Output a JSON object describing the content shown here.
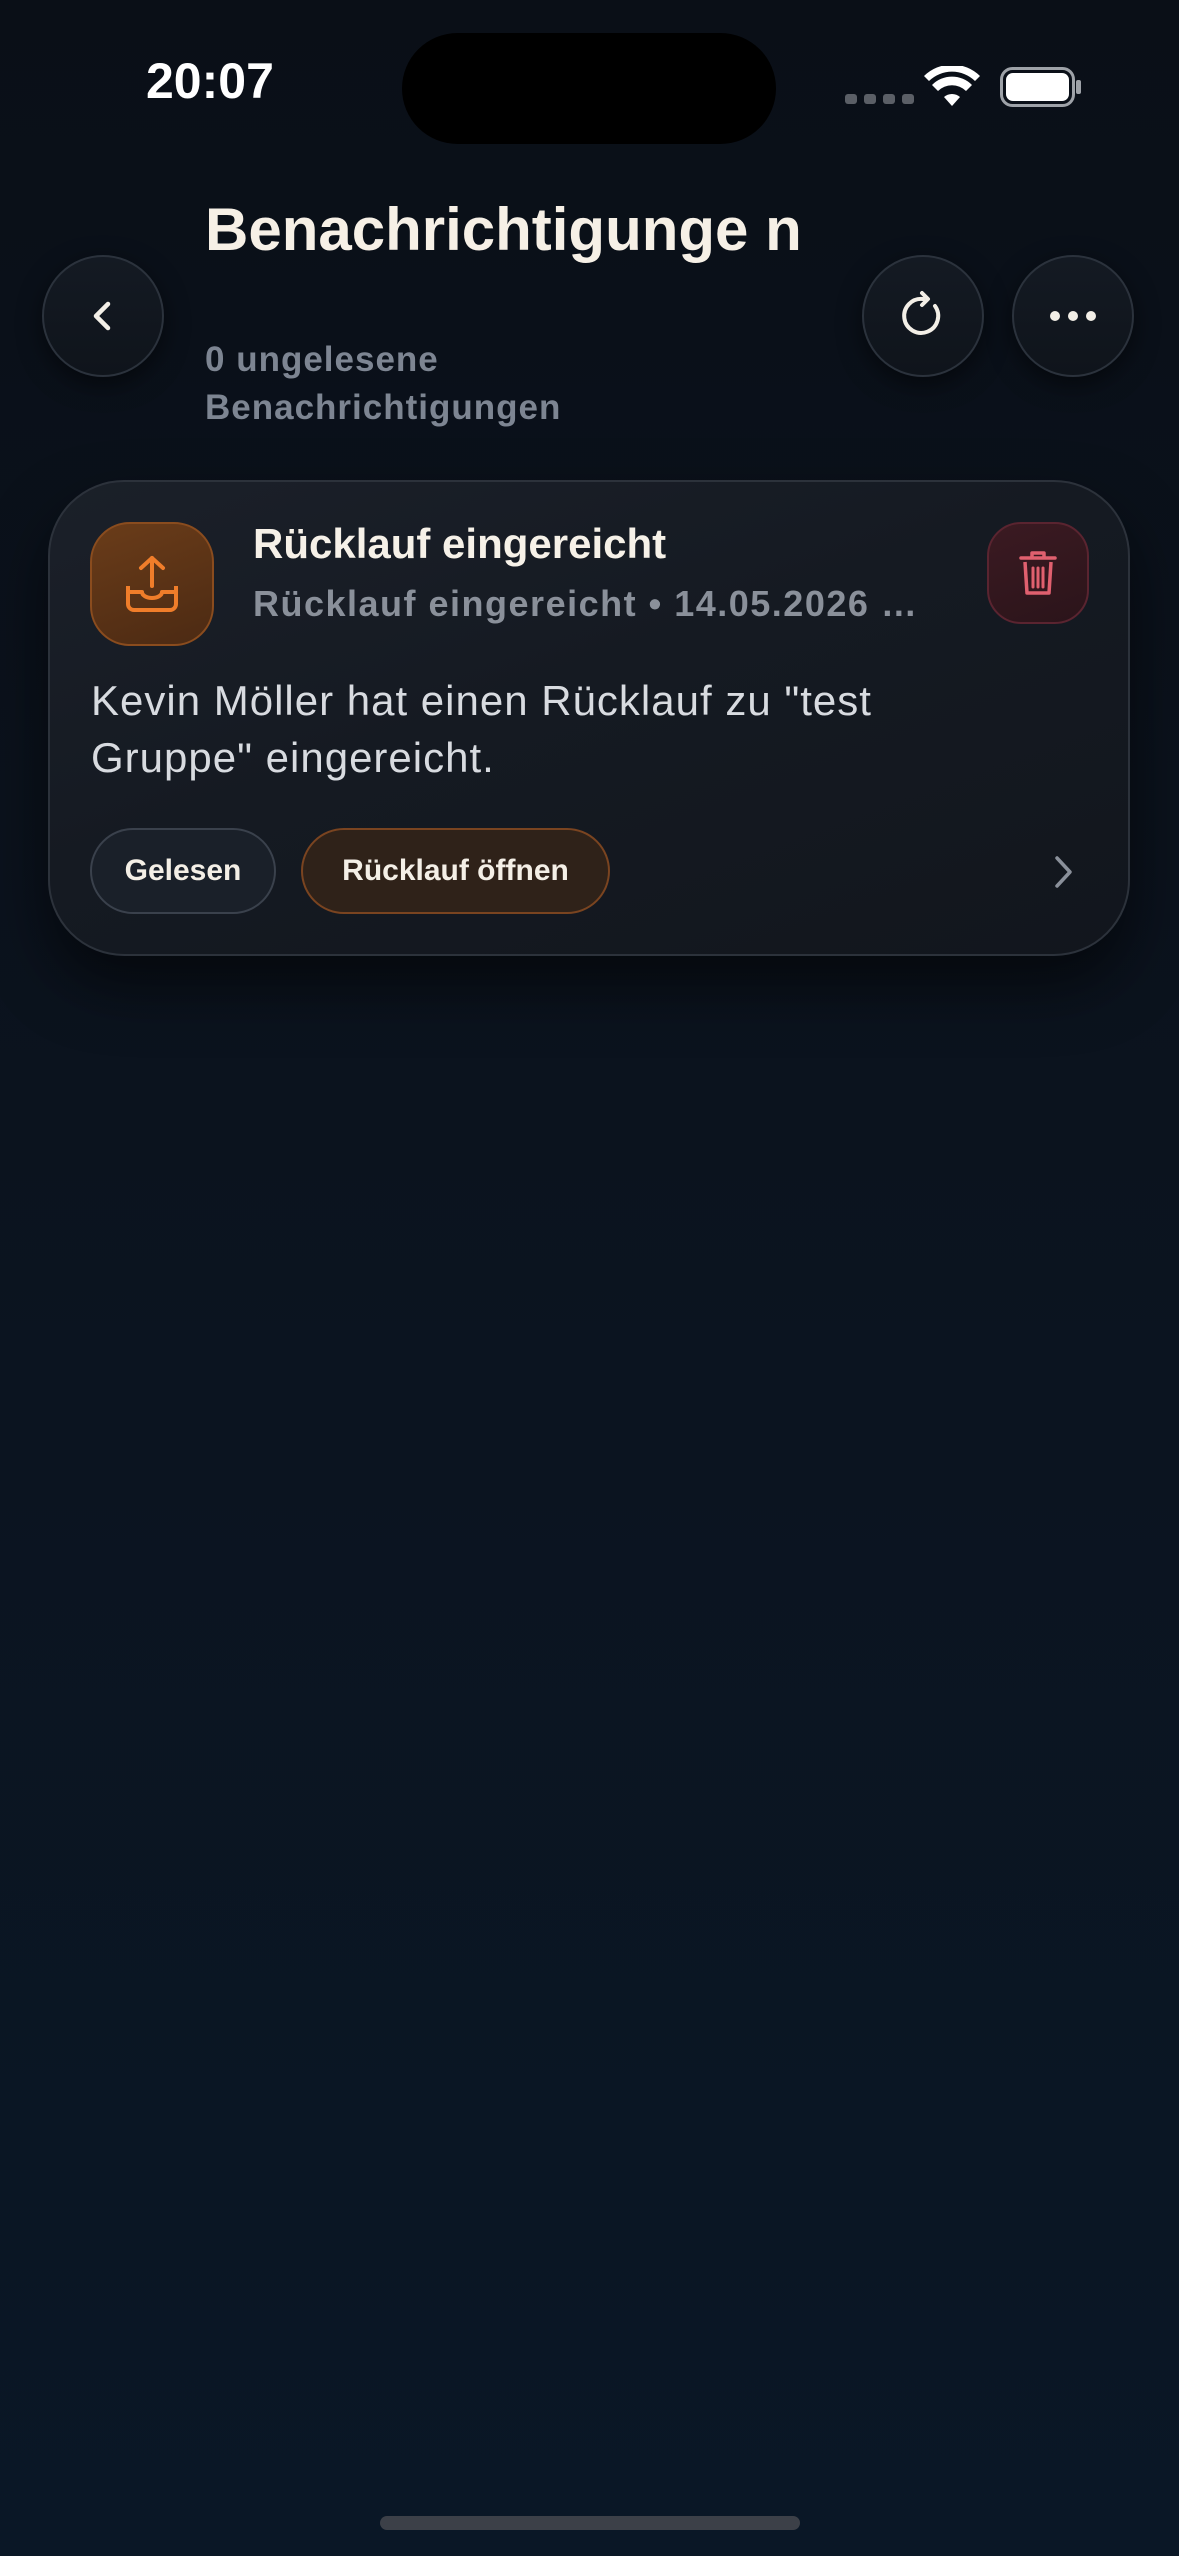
{
  "status_bar": {
    "time": "20:07"
  },
  "header": {
    "title": "Benachrichtigunge n",
    "subtitle": "0 ungelesene Benachrichtigungen",
    "back_icon": "chevron-left-icon",
    "refresh_icon": "refresh-icon",
    "more_icon": "ellipsis-icon"
  },
  "notification": {
    "icon": "inbox-upload-icon",
    "title": "Rücklauf eingereicht",
    "meta": "Rücklauf eingereicht • 14.05.2026 …",
    "body": "Kevin Möller hat einen Rücklauf zu \"test Gruppe\" eingereicht.",
    "read_label": "Gelesen",
    "open_label": "Rücklauf öffnen",
    "delete_icon": "trash-icon",
    "chevron_icon": "chevron-right-icon"
  },
  "colors": {
    "background": "#0a0f17",
    "accent_orange": "#f07d2a",
    "delete_red": "#e0606f",
    "text_primary": "#f6f1e8",
    "text_secondary": "#8a909a"
  }
}
